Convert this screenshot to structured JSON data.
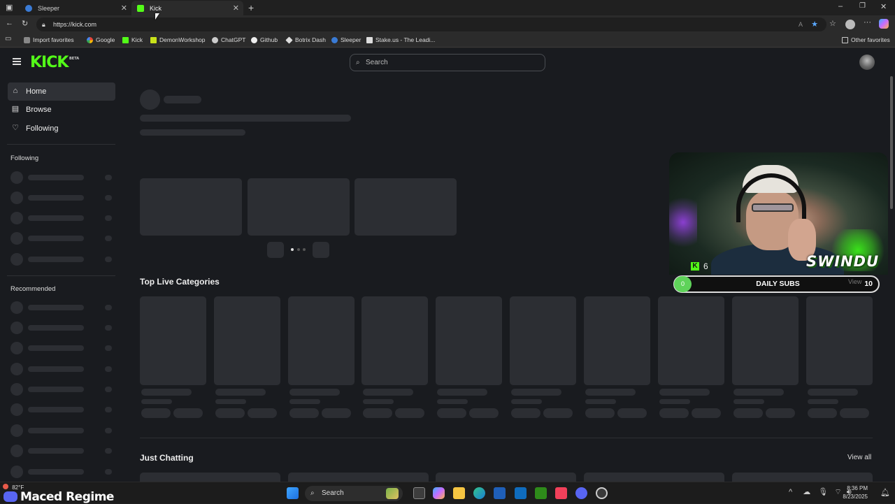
{
  "tabs": [
    {
      "title": "Sleeper",
      "active": false
    },
    {
      "title": "Kick",
      "active": true
    }
  ],
  "address": {
    "url": "https://kick.com"
  },
  "bookmarks": [
    {
      "label": "Import favorites",
      "icon": "import-icon"
    },
    {
      "label": "Google",
      "icon": "google-icon"
    },
    {
      "label": "Kick",
      "icon": "kick-icon"
    },
    {
      "label": "DemonWorkshop",
      "icon": "demonworkshop-icon"
    },
    {
      "label": "ChatGPT",
      "icon": "chatgpt-icon"
    },
    {
      "label": "Github",
      "icon": "github-icon"
    },
    {
      "label": "Botrix Dash",
      "icon": "botrix-icon"
    },
    {
      "label": "Sleeper",
      "icon": "sleeper-icon"
    },
    {
      "label": "Stake.us - The Leadi...",
      "icon": "stake-icon"
    }
  ],
  "other_favorites": "Other favorites",
  "kick": {
    "logo": "KICK",
    "logo_badge": "BETA",
    "search_placeholder": "Search",
    "nav": [
      {
        "label": "Home",
        "icon": "home-icon",
        "active": true
      },
      {
        "label": "Browse",
        "icon": "browse-icon",
        "active": false
      },
      {
        "label": "Following",
        "icon": "heart-icon",
        "active": false
      }
    ],
    "following_heading": "Following",
    "recommended_heading": "Recommended",
    "top_live_categories": "Top Live Categories",
    "just_chatting": "Just Chatting",
    "view_all": "View all"
  },
  "overlay": {
    "streamer_name": "SWINDU",
    "kick_count": "6",
    "subs_label": "DAILY SUBS",
    "subs_current": "0",
    "subs_goal": "10",
    "faded_view": "View"
  },
  "taskbar": {
    "weather_temp": "82°F",
    "weather_overlay_text": "Maced Regime",
    "search": "Search",
    "time": "8:36 PM",
    "date": "8/23/2025"
  },
  "colors": {
    "kick_green": "#53fc18",
    "page_bg": "#191b1f",
    "skeleton": "#2c2e33"
  }
}
